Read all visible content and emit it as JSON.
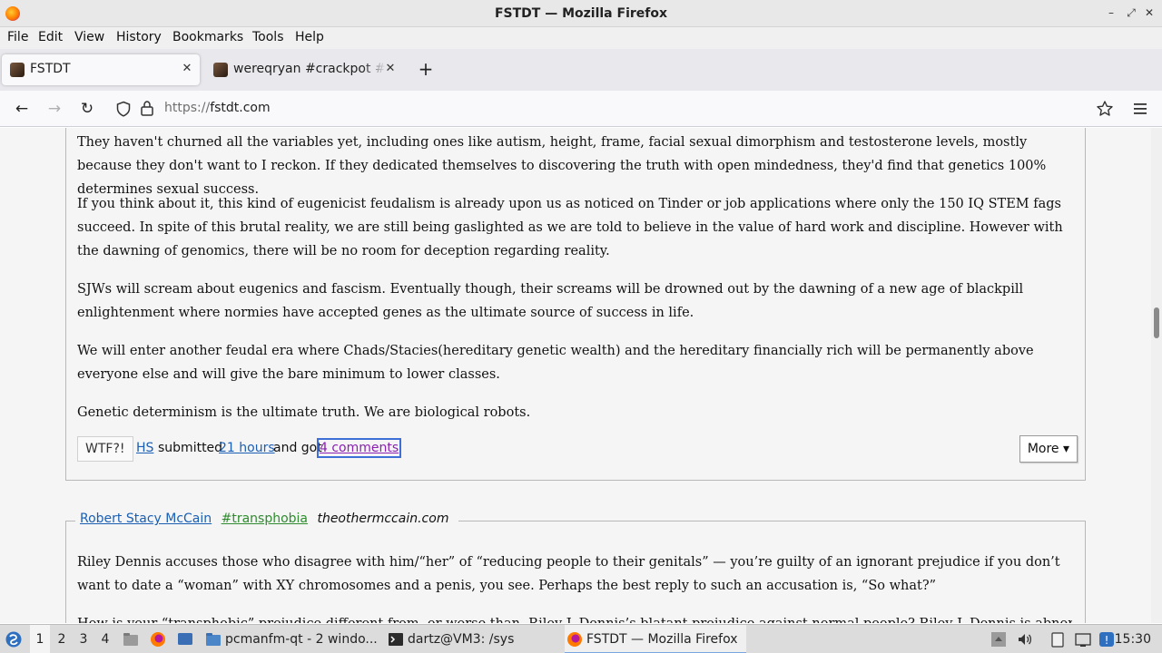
{
  "window": {
    "title": "FSTDT — Mozilla Firefox",
    "controls": {
      "minimize": "–",
      "maximize": "⤢",
      "close": "✕"
    }
  },
  "menubar": [
    "File",
    "Edit",
    "View",
    "History",
    "Bookmarks",
    "Tools",
    "Help"
  ],
  "tabs": [
    {
      "label": "FSTDT",
      "active": true
    },
    {
      "label": "wereqryan #crackpot #d",
      "active": false
    }
  ],
  "toolbar": {
    "url_scheme": "https://",
    "url_host": "fstdt.com"
  },
  "post1": {
    "paragraphs": [
      "They haven't churned all the variables yet, including ones like autism, height, frame, facial sexual dimorphism and testosterone levels, mostly because they don't want to I reckon. If they dedicated themselves to discovering the truth with open mindedness, they'd find that genetics 100% determines sexual success.",
      "If you think about it, this kind of eugenicist feudalism is already upon us as noticed on Tinder or job applications where only the 150 IQ STEM fags succeed. In spite of this brutal reality, we are still being gaslighted as we are told to believe in the value of hard work and discipline. However with the dawning of genomics, there will be no room for deception regarding reality.",
      "SJWs will scream about eugenics and fascism. Eventually though, their screams will be drowned out by the dawning of a new age of blackpill enlightenment where normies have accepted genes as the ultimate source of success in life.",
      "We will enter another feudal era where Chads/Stacies(hereditary genetic wealth) and the hereditary financially rich will be permanently above everyone else and will give the bare minimum to lower classes.",
      "Genetic determinism is the ultimate truth. We are biological robots."
    ],
    "footer": {
      "wtf_label": "WTF?!",
      "submitter": "HS",
      "submitted_text": "submitted",
      "time": "21 hours",
      "got_text": "and got",
      "comments": "4 comments",
      "more_label": "More ▾"
    }
  },
  "post2": {
    "author": "Robert Stacy McCain",
    "tag": "#transphobia",
    "site": "theothermccain.com",
    "paragraphs": [
      "Riley Dennis accuses those who disagree with him/“her” of “reducing people to their genitals” — you’re guilty of an ignorant prejudice if you don’t want to date a “woman” with XY chromosomes and a penis, you see. Perhaps the best reply to such an accusation is, “So what?”",
      "How is your “transphobic” prejudice different from, or worse than, Riley J. Dennis’s blatant prejudice against normal people? Riley J. Dennis is abnormal, and expects the"
    ]
  },
  "taskbar": {
    "workspaces": [
      "1",
      "2",
      "3",
      "4"
    ],
    "windows": [
      {
        "label": "pcmanfm-qt - 2 windo...",
        "icon": "folder-icon"
      },
      {
        "label": "dartz@VM3: /sys",
        "icon": "terminal-icon"
      },
      {
        "label": "FSTDT — Mozilla Firefox",
        "icon": "firefox-icon"
      }
    ],
    "clock": "15:30"
  }
}
